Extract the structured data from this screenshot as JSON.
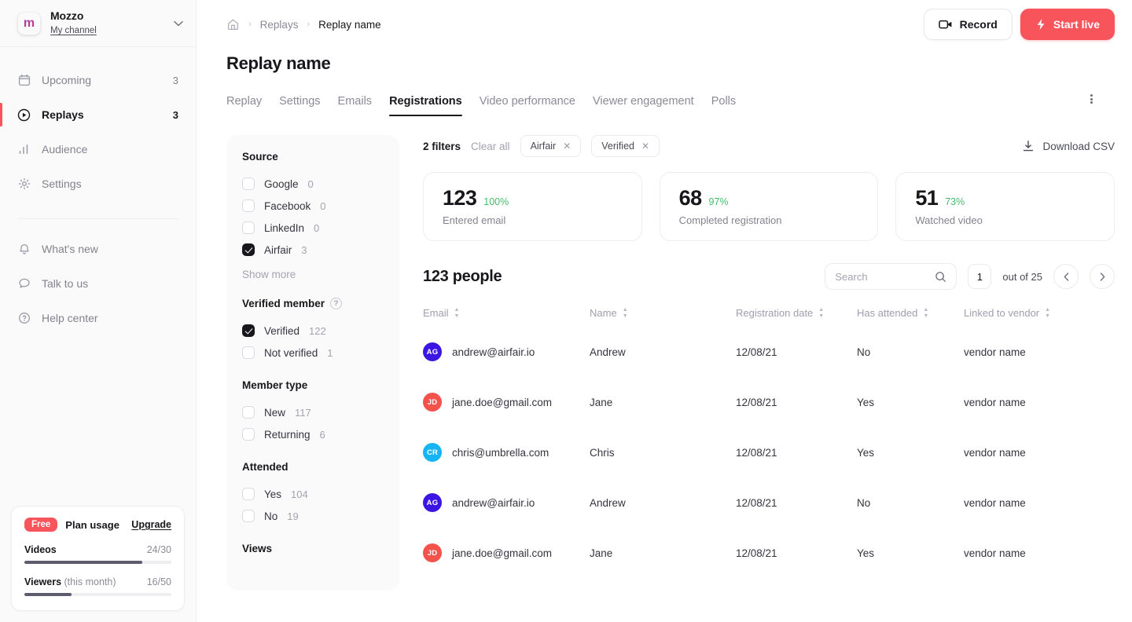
{
  "sidebar": {
    "brand": {
      "logo_letter": "m",
      "name": "Mozzo",
      "subtitle": "My channel",
      "chevron_icon": "chevron-down-icon"
    },
    "nav": [
      {
        "label": "Upcoming",
        "count": "3",
        "icon": "calendar-icon",
        "active": false
      },
      {
        "label": "Replays",
        "count": "3",
        "icon": "play-circle-icon",
        "active": true
      },
      {
        "label": "Audience",
        "count": "",
        "icon": "bar-chart-icon",
        "active": false
      },
      {
        "label": "Settings",
        "count": "",
        "icon": "gear-icon",
        "active": false
      }
    ],
    "secondary_nav": [
      {
        "label": "What's new",
        "icon": "bell-icon"
      },
      {
        "label": "Talk to us",
        "icon": "chat-icon"
      },
      {
        "label": "Help center",
        "icon": "question-circle-icon"
      }
    ],
    "plan": {
      "badge": "Free",
      "label": "Plan usage",
      "upgrade": "Upgrade",
      "usage": [
        {
          "name": "Videos",
          "suffix": "",
          "value": "24/30",
          "percent": 80
        },
        {
          "name": "Viewers",
          "suffix": " (this month)",
          "value": "16/50",
          "percent": 32
        }
      ]
    }
  },
  "topbar": {
    "breadcrumb": {
      "home_icon": "home-icon",
      "items": [
        "Replays",
        "Replay name"
      ],
      "separator": "›"
    },
    "record_button": "Record",
    "record_icon": "video-camera-icon",
    "start_live_button": "Start live",
    "start_live_icon": "lightning-bolt-icon",
    "accent_color": "#f8545c"
  },
  "page": {
    "title": "Replay name",
    "tabs": [
      {
        "label": "Replay",
        "active": false
      },
      {
        "label": "Settings",
        "active": false
      },
      {
        "label": "Emails",
        "active": false
      },
      {
        "label": "Registrations",
        "active": true
      },
      {
        "label": "Video performance",
        "active": false
      },
      {
        "label": "Viewer engagement",
        "active": false
      },
      {
        "label": "Polls",
        "active": false
      }
    ],
    "overflow_icon": "kebab-menu-icon"
  },
  "filters_panel": {
    "groups": [
      {
        "title": "Source",
        "has_help": false,
        "options": [
          {
            "label": "Google",
            "count": "0",
            "checked": false
          },
          {
            "label": "Facebook",
            "count": "0",
            "checked": false
          },
          {
            "label": "LinkedIn",
            "count": "0",
            "checked": false
          },
          {
            "label": "Airfair",
            "count": "3",
            "checked": true
          }
        ],
        "show_more": "Show more"
      },
      {
        "title": "Verified member",
        "has_help": true,
        "help_icon": "question-mark-icon",
        "options": [
          {
            "label": "Verified",
            "count": "122",
            "checked": true
          },
          {
            "label": "Not verified",
            "count": "1",
            "checked": false
          }
        ]
      },
      {
        "title": "Member type",
        "has_help": false,
        "options": [
          {
            "label": "New",
            "count": "117",
            "checked": false
          },
          {
            "label": "Returning",
            "count": "6",
            "checked": false
          }
        ]
      },
      {
        "title": "Attended",
        "has_help": false,
        "options": [
          {
            "label": "Yes",
            "count": "104",
            "checked": false
          },
          {
            "label": "No",
            "count": "19",
            "checked": false
          }
        ]
      },
      {
        "title": "Views",
        "has_help": false,
        "options": []
      }
    ]
  },
  "filter_bar": {
    "count_label": "2 filters",
    "clear_all": "Clear all",
    "chips": [
      {
        "label": "Airfair",
        "remove_icon": "close-icon"
      },
      {
        "label": "Verified",
        "remove_icon": "close-icon"
      }
    ],
    "download_label": "Download CSV",
    "download_icon": "download-icon"
  },
  "stats": [
    {
      "value": "123",
      "percent": "100%",
      "label": "Entered email"
    },
    {
      "value": "68",
      "percent": "97%",
      "label": "Completed registration"
    },
    {
      "value": "51",
      "percent": "73%",
      "label": "Watched video"
    }
  ],
  "stat_percent_color": "#45bd6b",
  "list_header": {
    "people_count": "123 people",
    "search_placeholder": "Search",
    "search_value": "",
    "search_icon": "search-icon",
    "page_value": "1",
    "page_of": "out of 25",
    "prev_icon": "chevron-left-icon",
    "next_icon": "chevron-right-icon"
  },
  "table": {
    "columns": [
      {
        "label": "Email",
        "sortable": true
      },
      {
        "label": "Name",
        "sortable": true
      },
      {
        "label": "Registration date",
        "sortable": true
      },
      {
        "label": "Has attended",
        "sortable": true
      },
      {
        "label": "Linked to vendor",
        "sortable": true
      }
    ],
    "rows": [
      {
        "initials": "AG",
        "avatar_color": "#3c16e0",
        "email": "andrew@airfair.io",
        "name": "Andrew",
        "date": "12/08/21",
        "attended": "No",
        "vendor": "vendor name"
      },
      {
        "initials": "JD",
        "avatar_color": "#f4524d",
        "email": "jane.doe@gmail.com",
        "name": "Jane",
        "date": "12/08/21",
        "attended": "Yes",
        "vendor": "vendor name"
      },
      {
        "initials": "CR",
        "avatar_color": "#16b4f0",
        "email": "chris@umbrella.com",
        "name": "Chris",
        "date": "12/08/21",
        "attended": "Yes",
        "vendor": "vendor name"
      },
      {
        "initials": "AG",
        "avatar_color": "#3c16e0",
        "email": "andrew@airfair.io",
        "name": "Andrew",
        "date": "12/08/21",
        "attended": "No",
        "vendor": "vendor name"
      },
      {
        "initials": "JD",
        "avatar_color": "#f4524d",
        "email": "jane.doe@gmail.com",
        "name": "Jane",
        "date": "12/08/21",
        "attended": "Yes",
        "vendor": "vendor name"
      }
    ]
  }
}
